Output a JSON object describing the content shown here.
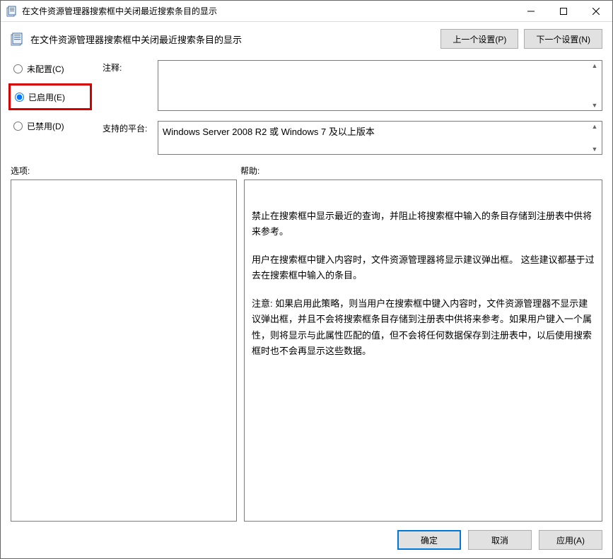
{
  "titlebar": {
    "text": "在文件资源管理器搜索框中关闭最近搜索条目的显示"
  },
  "header": {
    "title": "在文件资源管理器搜索框中关闭最近搜索条目的显示",
    "prev": "上一个设置(P)",
    "next": "下一个设置(N)"
  },
  "radios": {
    "not_configured": "未配置(C)",
    "enabled": "已启用(E)",
    "disabled": "已禁用(D)"
  },
  "labels": {
    "comment": "注释:",
    "supported": "支持的平台:",
    "options": "选项:",
    "help": "帮助:"
  },
  "values": {
    "comment": "",
    "supported": "Windows Server 2008 R2 或 Windows 7 及以上版本"
  },
  "help": {
    "p1": "禁止在搜索框中显示最近的查询，并阻止将搜索框中输入的条目存储到注册表中供将来参考。",
    "p2": "用户在搜索框中键入内容时，文件资源管理器将显示建议弹出框。 这些建议都基于过去在搜索框中输入的条目。",
    "p3": "注意: 如果启用此策略，则当用户在搜索框中键入内容时，文件资源管理器不显示建议弹出框，并且不会将搜索框条目存储到注册表中供将来参考。如果用户键入一个属性，则将显示与此属性匹配的值，但不会将任何数据保存到注册表中，以后使用搜索框时也不会再显示这些数据。"
  },
  "footer": {
    "ok": "确定",
    "cancel": "取消",
    "apply": "应用(A)"
  }
}
